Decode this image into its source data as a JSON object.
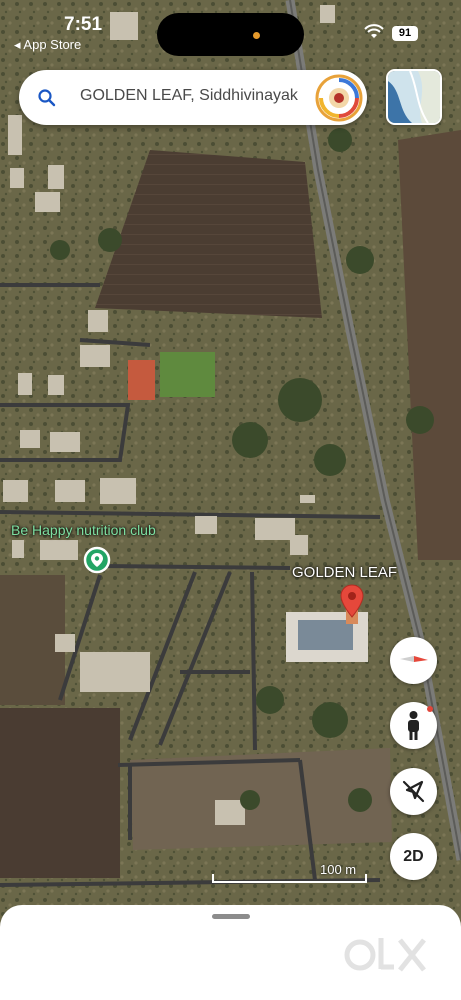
{
  "status_bar": {
    "time": "7:51",
    "back_label": "◂ App Store",
    "battery": "91"
  },
  "search": {
    "query": "GOLDEN LEAF, Siddhivinayak",
    "icon": "search-icon"
  },
  "map": {
    "labels": {
      "poi": "Be Happy nutrition club",
      "destination": "GOLDEN LEAF"
    }
  },
  "controls": {
    "view_toggle": "2D"
  },
  "scale": {
    "label": "100 m"
  },
  "watermark": {
    "text": "OLX"
  },
  "colors": {
    "pin_red": "#e5483b",
    "poi_green": "#22a565",
    "label_green": "#7ee0a2"
  }
}
